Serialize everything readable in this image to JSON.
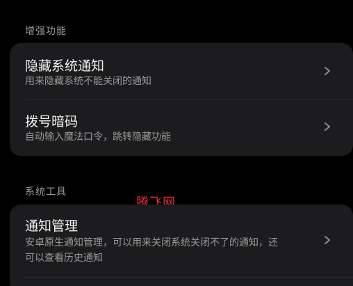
{
  "sections": [
    {
      "header": "增强功能",
      "items": [
        {
          "title": "隐藏系统通知",
          "desc": "用来隐藏系统不能关闭的通知"
        },
        {
          "title": "拨号暗码",
          "desc": "自动输入魔法口令，跳转隐藏功能"
        }
      ]
    },
    {
      "header": "系统工具",
      "items": [
        {
          "title": "通知管理",
          "desc_line1": "安卓原生通知管理，可以用来关闭系统关闭不了的通知，还",
          "desc_line2": "可以查看历史通知"
        }
      ]
    }
  ],
  "watermark": "腾飞网",
  "colors": {
    "background": "#000000",
    "card": "#1c1c1e",
    "title": "#f2f2f2",
    "secondary": "#9a9a9a",
    "watermark": "#e03030"
  },
  "icons": {
    "row_arrow": "chevron-right-icon"
  }
}
